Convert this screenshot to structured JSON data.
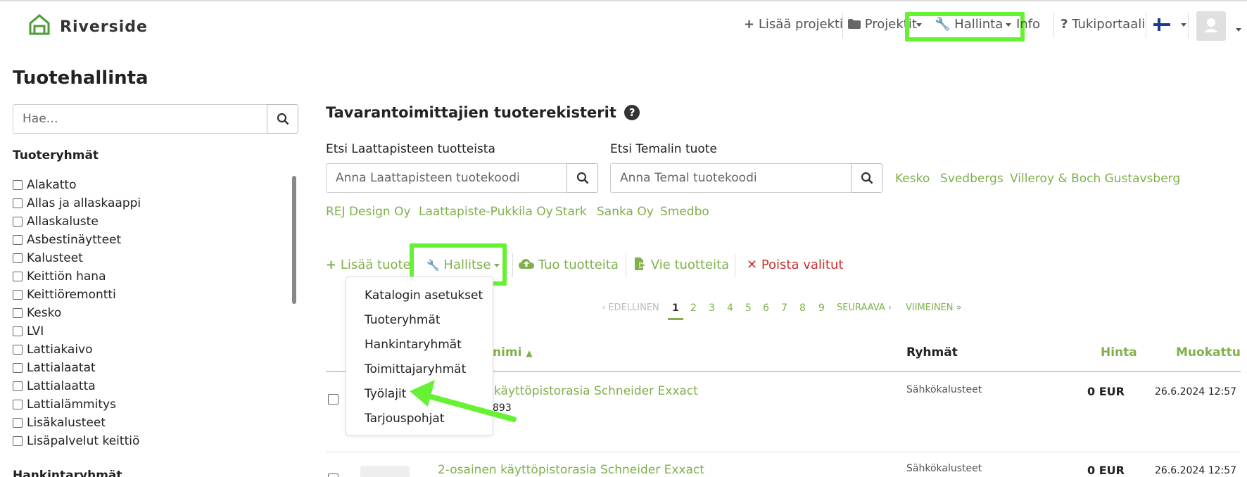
{
  "brand": {
    "name": "Riverside"
  },
  "nav": {
    "add_project": "Lisää projekti",
    "projects": "Projektit",
    "admin": "Hallinta",
    "info": "Info",
    "support": "Tukiportaali"
  },
  "sidebar": {
    "title": "Tuotehallinta",
    "search_placeholder": "Hae…",
    "groups_title": "Tuoteryhmät",
    "groups": [
      "Alakatto",
      "Allas ja allaskaappi",
      "Allaskaluste",
      "Asbestinäytteet",
      "Kalusteet",
      "Keittiön hana",
      "Keittiöremontti",
      "Kesko",
      "LVI",
      "Lattiakaivo",
      "Lattialaatat",
      "Lattialaatta",
      "Lattialämmitys",
      "Lisäkalusteet",
      "Lisäpalvelut keittiö"
    ],
    "purchase_groups_title": "Hankintaryhmät"
  },
  "main": {
    "heading": "Tavarantoimittajien tuoterekisterit",
    "search1": {
      "label": "Etsi Laattapisteen tuotteista",
      "placeholder": "Anna Laattapisteen tuotekoodi"
    },
    "search2": {
      "label": "Etsi Temalin tuote",
      "placeholder": "Anna Temal tuotekoodi"
    },
    "suppliers": [
      "Kesko",
      "Svedbergs",
      "Villeroy & Boch Gustavsberg",
      "REJ Design Oy",
      "Laattapiste-Pukkila Oy",
      "Stark",
      "Sanka Oy",
      "Smedbo"
    ],
    "toolbar": {
      "add": "Lisää tuote",
      "manage": "Hallitse",
      "import": "Tuo tuotteita",
      "export": "Vie tuotteita",
      "delete": "Poista valitut"
    },
    "dropdown": [
      "Katalogin asetukset",
      "Tuoteryhmät",
      "Hankintaryhmät",
      "Toimittajaryhmät",
      "Työlajit",
      "Tarjouspohjat"
    ],
    "pagination": {
      "prev": "EDELLINEN",
      "pages": [
        "1",
        "2",
        "3",
        "4",
        "5",
        "6",
        "7",
        "8",
        "9"
      ],
      "next": "SEURAAVA",
      "last": "VIIMEINEN",
      "current": "1"
    },
    "table": {
      "col_name": "nimi",
      "col_groups": "Ryhmät",
      "col_price": "Hinta",
      "col_modified": "Muokattu",
      "rows": [
        {
          "name": "käyttöpistorasia Schneider Exxact",
          "code": "893",
          "group": "Sähkökalusteet",
          "price": "0 EUR",
          "modified": "26.6.2024 12:57"
        },
        {
          "name": "2-osainen käyttöpistorasia Schneider Exxact",
          "code": "",
          "group": "Sähkökalusteet",
          "price": "0 EUR",
          "modified": "26.6.2024 12:57"
        }
      ]
    }
  },
  "colors": {
    "accent": "#7fb04a",
    "highlight": "#66f233",
    "danger": "#c9302c"
  }
}
